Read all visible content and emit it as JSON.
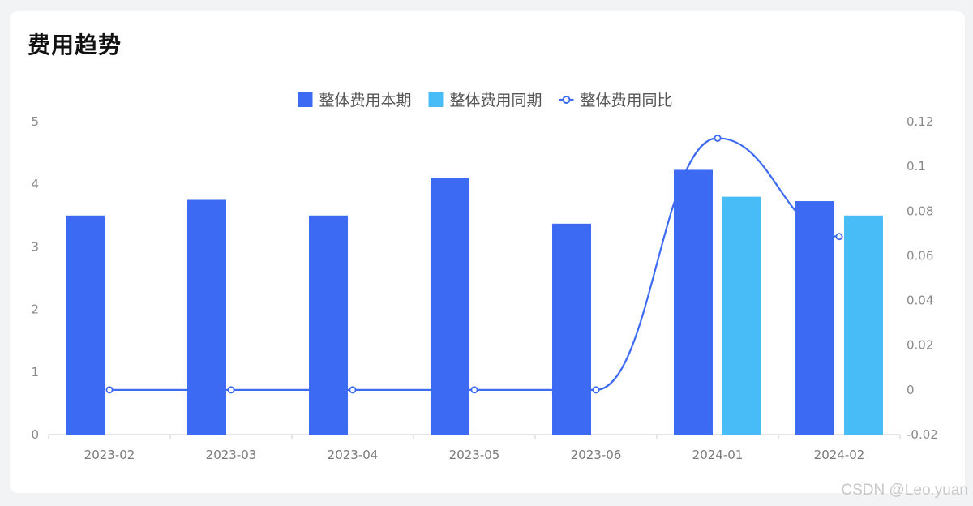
{
  "card": {
    "title": "费用趋势"
  },
  "watermark": "CSDN @Leo.yuan",
  "chart_data": {
    "type": "bar",
    "categories": [
      "2023-02",
      "2023-03",
      "2023-04",
      "2023-05",
      "2023-06",
      "2024-01",
      "2024-02"
    ],
    "series": [
      {
        "name": "整体费用本期",
        "kind": "bar",
        "axis": "left",
        "color": "#3d6af2",
        "values": [
          3.5,
          3.75,
          3.5,
          4.1,
          3.37,
          4.23,
          3.73
        ]
      },
      {
        "name": "整体费用同期",
        "kind": "bar",
        "axis": "left",
        "color": "#48bcf7",
        "values": [
          null,
          null,
          null,
          null,
          null,
          3.8,
          3.5
        ]
      },
      {
        "name": "整体费用同比",
        "kind": "line",
        "smooth": true,
        "axis": "right",
        "color": "#3d6af2",
        "values": [
          0,
          0,
          0,
          0,
          0,
          0.1126,
          0.0686
        ]
      }
    ],
    "y_left": {
      "ylim": [
        0,
        5
      ],
      "ticks": [
        "0",
        "1",
        "2",
        "3",
        "4",
        "5"
      ]
    },
    "y_right": {
      "ylim": [
        -0.02,
        0.12
      ],
      "ticks": [
        "-0.02",
        "0",
        "0.02",
        "0.04",
        "0.06",
        "0.08",
        "0.1",
        "0.12"
      ]
    },
    "legend": "top-center",
    "grid": false
  }
}
